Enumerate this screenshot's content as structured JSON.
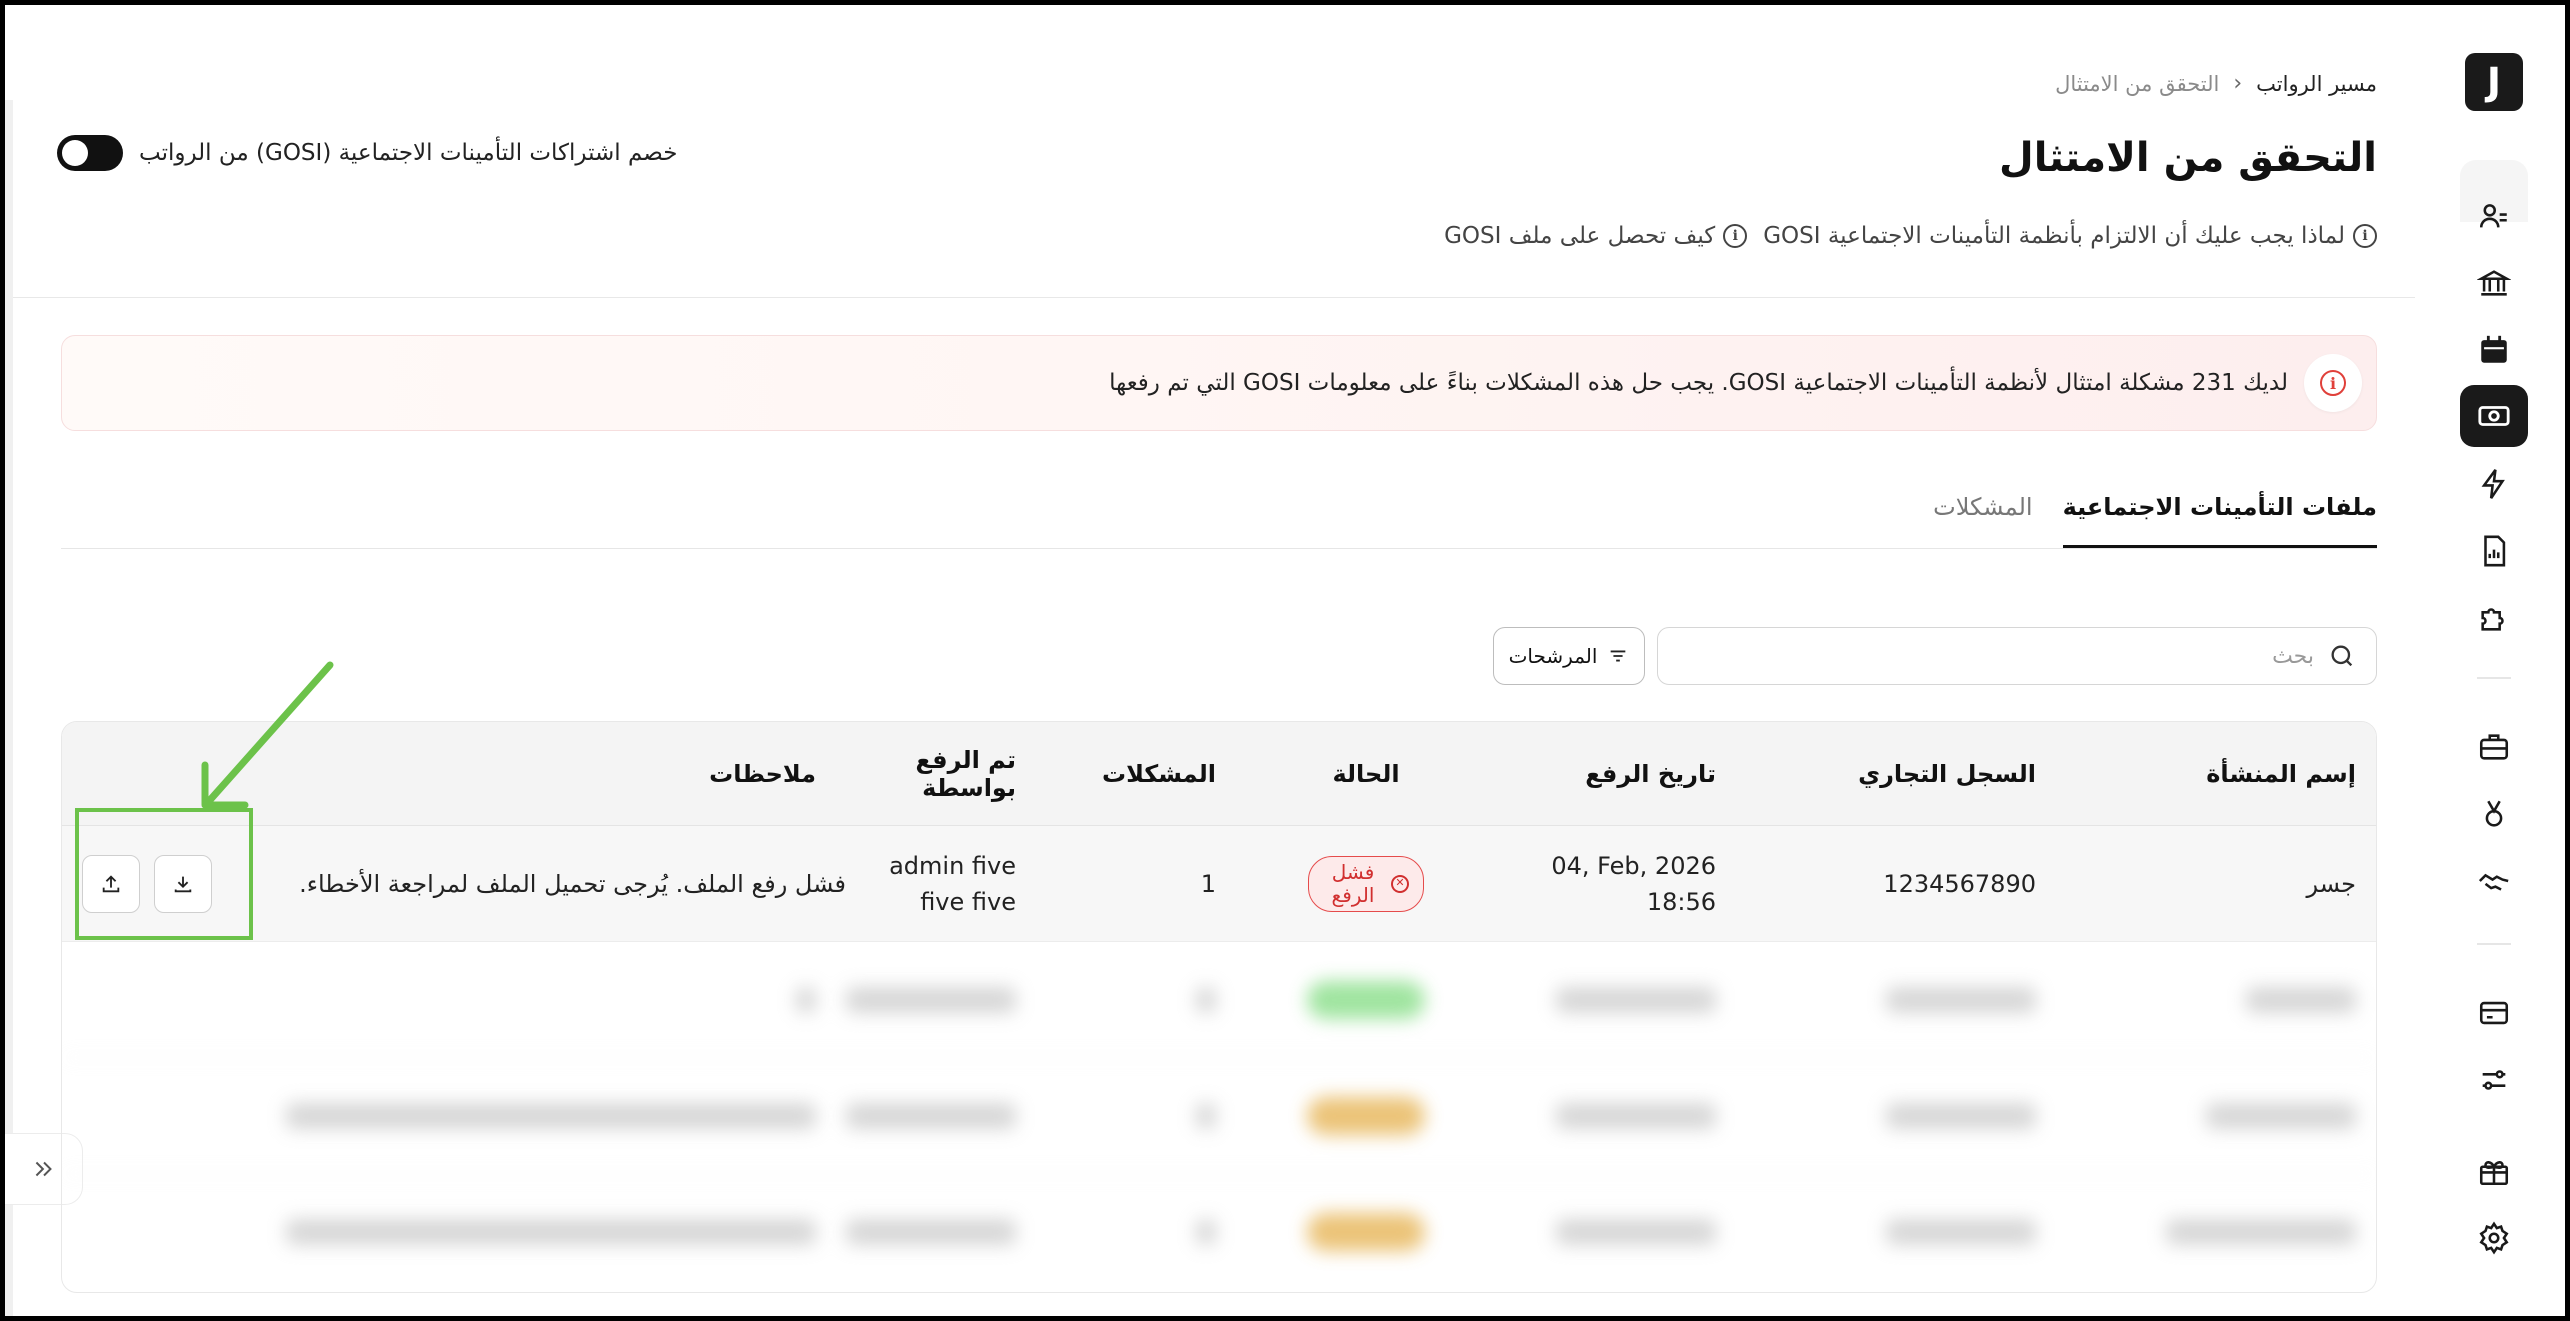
{
  "breadcrumb": {
    "parent": "مسير الرواتب",
    "current": "التحقق من الامتثال"
  },
  "page": {
    "title": "التحقق من الامتثال"
  },
  "links": {
    "why": "لماذا يجب عليك أن الالتزام بأنظمة التأمينات الاجتماعية GOSI",
    "how": "كيف تحصل على ملف GOSI"
  },
  "toggle": {
    "label": "خصم اشتراكات التأمينات الاجتماعية (GOSI) من الرواتب",
    "state": "off"
  },
  "alert": {
    "text": "لديك 231 مشكلة امتثال لأنظمة التأمينات الاجتماعية GOSI. يجب حل هذه المشكلات بناءً على معلومات GOSI التي تم رفعها",
    "color": "#e0403a"
  },
  "tabs": [
    {
      "label": "ملفات التأمينات الاجتماعية",
      "active": true
    },
    {
      "label": "المشكلات",
      "active": false
    }
  ],
  "search": {
    "placeholder": "بحث"
  },
  "filters": {
    "label": "المرشحات"
  },
  "table": {
    "headers": {
      "name": "إسم المنشأة",
      "reg": "السجل التجاري",
      "date": "تاريخ الرفع",
      "status": "الحالة",
      "issues": "المشكلات",
      "by": "تم الرفع بواسطة",
      "notes": "ملاحظات"
    },
    "rows": [
      {
        "name": "جسر",
        "reg": "1234567890",
        "date": "04, Feb, 2026",
        "time": "18:56",
        "status": "فشل الرفع",
        "issues": "1",
        "by": "admin five five five",
        "notes": "فشل رفع الملف. يُرجى تحميل الملف لمراجعة الأخطاء."
      }
    ],
    "blurred_status_colors": [
      "#8fe08f",
      "#e8b960",
      "#e8b960"
    ]
  },
  "icons": {
    "upload": "upload-icon",
    "download": "download-icon",
    "search": "search-icon",
    "filter": "filter-icon",
    "expand": "chevron-double-icon"
  },
  "colors": {
    "highlight": "#6cc24a",
    "fail": "#d12f2f"
  }
}
